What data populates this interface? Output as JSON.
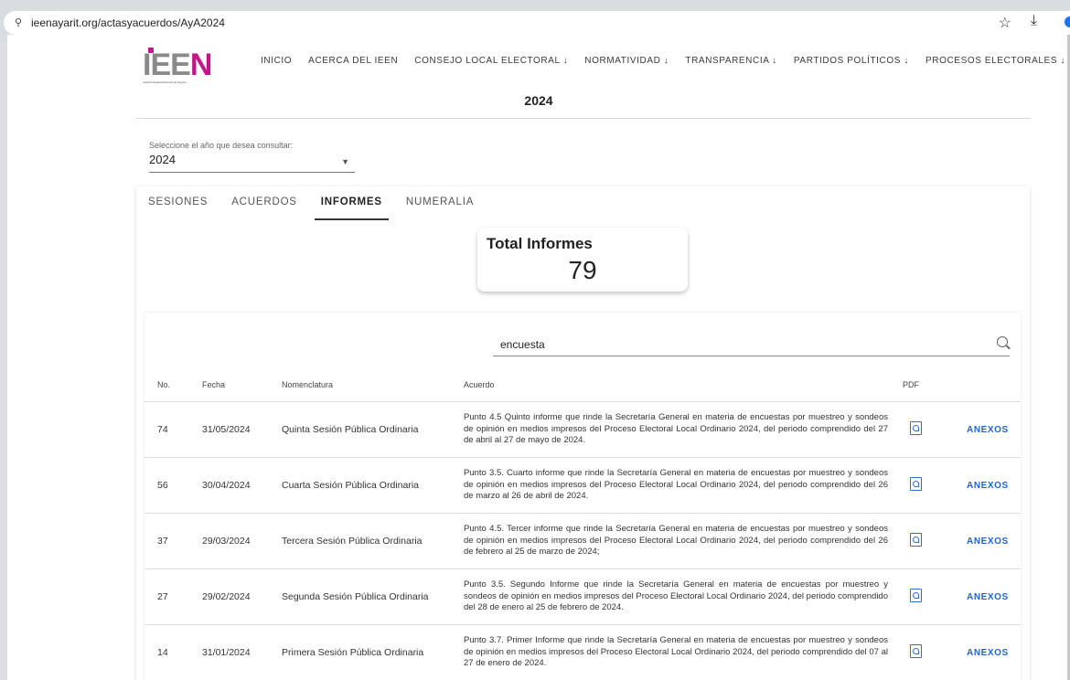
{
  "browser": {
    "url": "ieenayarit.org/actasyacuerdos/AyA2024"
  },
  "nav": {
    "logo_text": "IEEN",
    "logo_subtext": "Instituto Estatal Electoral de Nayarit",
    "items": [
      "INICIO",
      "ACERCA DEL IEEN",
      "CONSEJO LOCAL ELECTORAL ↓",
      "NORMATIVIDAD ↓",
      "TRANSPARENCIA ↓",
      "PARTIDOS POLÍTICOS ↓",
      "PROCESOS ELECTORALES ↓"
    ]
  },
  "page": {
    "title": "2024"
  },
  "year_select": {
    "label": "Seleccione el año que desea consultar:",
    "value": "2024"
  },
  "tabs": [
    "SESIONES",
    "ACUERDOS",
    "INFORMES",
    "NUMERALIA"
  ],
  "active_tab": "INFORMES",
  "total": {
    "label": "Total Informes",
    "value": "79"
  },
  "search": {
    "value": "encuesta"
  },
  "table": {
    "headers": [
      "No.",
      "Fecha",
      "Nomenclatura",
      "Acuerdo",
      "PDF",
      ""
    ],
    "rows": [
      {
        "no": "74",
        "fecha": "31/05/2024",
        "nomenclatura": "Quinta Sesión Pública Ordinaria",
        "acuerdo": "Punto 4.5 Quinto informe que rinde la Secretaría General en materia de encuestas por muestreo y sondeos de opinión en medios impresos del Proceso Electoral Local Ordinario 2024, del periodo comprendido del 27 de abril al 27 de mayo de 2024.",
        "anexos": "ANEXOS"
      },
      {
        "no": "56",
        "fecha": "30/04/2024",
        "nomenclatura": "Cuarta Sesión Pública Ordinaria",
        "acuerdo": "Punto 3.5. Cuarto informe que rinde la Secretaría General en materia de encuestas por muestreo y sondeos de opinión en medios impresos del Proceso Electoral Local Ordinario 2024, del periodo comprendido del 26 de marzo al 26 de abril de 2024.",
        "anexos": "ANEXOS"
      },
      {
        "no": "37",
        "fecha": "29/03/2024",
        "nomenclatura": "Tercera Sesión Pública Ordinaria",
        "acuerdo": "Punto 4.5. Tercer informe que rinde la Secretaría General en materia de encuestas por muestreo y sondeos de opinión en medios impresos del Proceso Electoral Local Ordinario 2024, del periodo comprendido del 26 de febrero al 25 de marzo de 2024;",
        "anexos": "ANEXOS"
      },
      {
        "no": "27",
        "fecha": "29/02/2024",
        "nomenclatura": "Segunda Sesión Pública Ordinaria",
        "acuerdo": "Punto 3.5. Segundo Informe que rinde la Secretaría General en materia de encuestas por muestreo y sondeos de opinión en medios impresos del Proceso Electoral Local Ordinario 2024, del periodo comprendido del 28 de enero al 25 de febrero de 2024.",
        "anexos": "ANEXOS"
      },
      {
        "no": "14",
        "fecha": "31/01/2024",
        "nomenclatura": "Primera Sesión Pública Ordinaria",
        "acuerdo": "Punto 3.7. Primer Informe que rinde la Secretaría General en materia de encuestas por muestreo y sondeos de opinión en medios impresos del Proceso Electoral Local Ordinario 2024, del periodo comprendido del 07 al 27 de enero de 2024.",
        "anexos": "ANEXOS"
      }
    ]
  },
  "colors": {
    "brand_magenta": "#c2168a",
    "link_blue": "#1f66c8",
    "pdf_blue": "#2d6fd6"
  }
}
